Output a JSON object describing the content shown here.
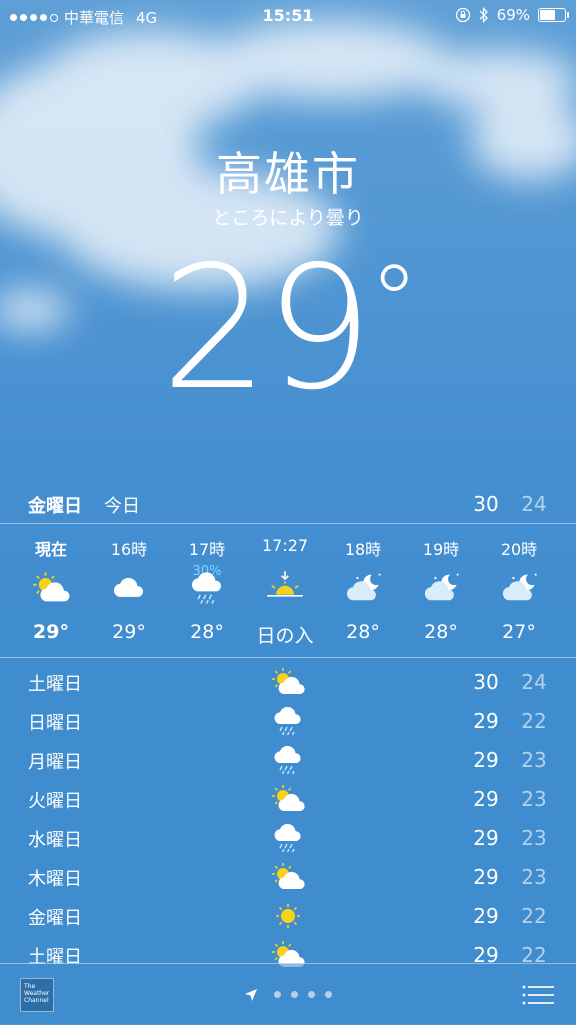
{
  "status_bar": {
    "carrier": "中華電信",
    "network": "4G",
    "time": "15:51",
    "battery": "69%",
    "battery_level": 0.69
  },
  "location": {
    "city": "高雄市",
    "condition": "ところにより曇り",
    "temperature": "29",
    "degree_symbol": "°"
  },
  "today": {
    "day": "金曜日",
    "label": "今日",
    "high": "30",
    "low": "24"
  },
  "hourly": [
    {
      "time": "現在",
      "icon": "partly-sunny-icon",
      "temp": "29°",
      "pop": ""
    },
    {
      "time": "16時",
      "icon": "cloud-icon",
      "temp": "29°",
      "pop": ""
    },
    {
      "time": "17時",
      "icon": "rain-icon",
      "temp": "28°",
      "pop": "30%"
    },
    {
      "time": "17:27",
      "icon": "sunset-icon",
      "temp": "日の入",
      "pop": ""
    },
    {
      "time": "18時",
      "icon": "partly-cloudy-night-icon",
      "temp": "28°",
      "pop": ""
    },
    {
      "time": "19時",
      "icon": "partly-cloudy-night-icon",
      "temp": "28°",
      "pop": ""
    },
    {
      "time": "20時",
      "icon": "partly-cloudy-night-icon",
      "temp": "27°",
      "pop": ""
    }
  ],
  "daily": [
    {
      "day": "土曜日",
      "icon": "partly-sunny-icon",
      "high": "30",
      "low": "24"
    },
    {
      "day": "日曜日",
      "icon": "rain-icon",
      "high": "29",
      "low": "22"
    },
    {
      "day": "月曜日",
      "icon": "rain-icon",
      "high": "29",
      "low": "23"
    },
    {
      "day": "火曜日",
      "icon": "partly-sunny-icon",
      "high": "29",
      "low": "23"
    },
    {
      "day": "水曜日",
      "icon": "rain-icon",
      "high": "29",
      "low": "23"
    },
    {
      "day": "木曜日",
      "icon": "partly-sunny-icon",
      "high": "29",
      "low": "23"
    },
    {
      "day": "金曜日",
      "icon": "sun-icon",
      "high": "29",
      "low": "22"
    },
    {
      "day": "土曜日",
      "icon": "partly-sunny-icon",
      "high": "29",
      "low": "22"
    }
  ],
  "tab_bar": {
    "logo_text": "The Weather Channel",
    "page_count": 4
  },
  "colors": {
    "sky": "#4b92d1",
    "sun": "#f6d21a",
    "pop": "#7fd3ff"
  }
}
